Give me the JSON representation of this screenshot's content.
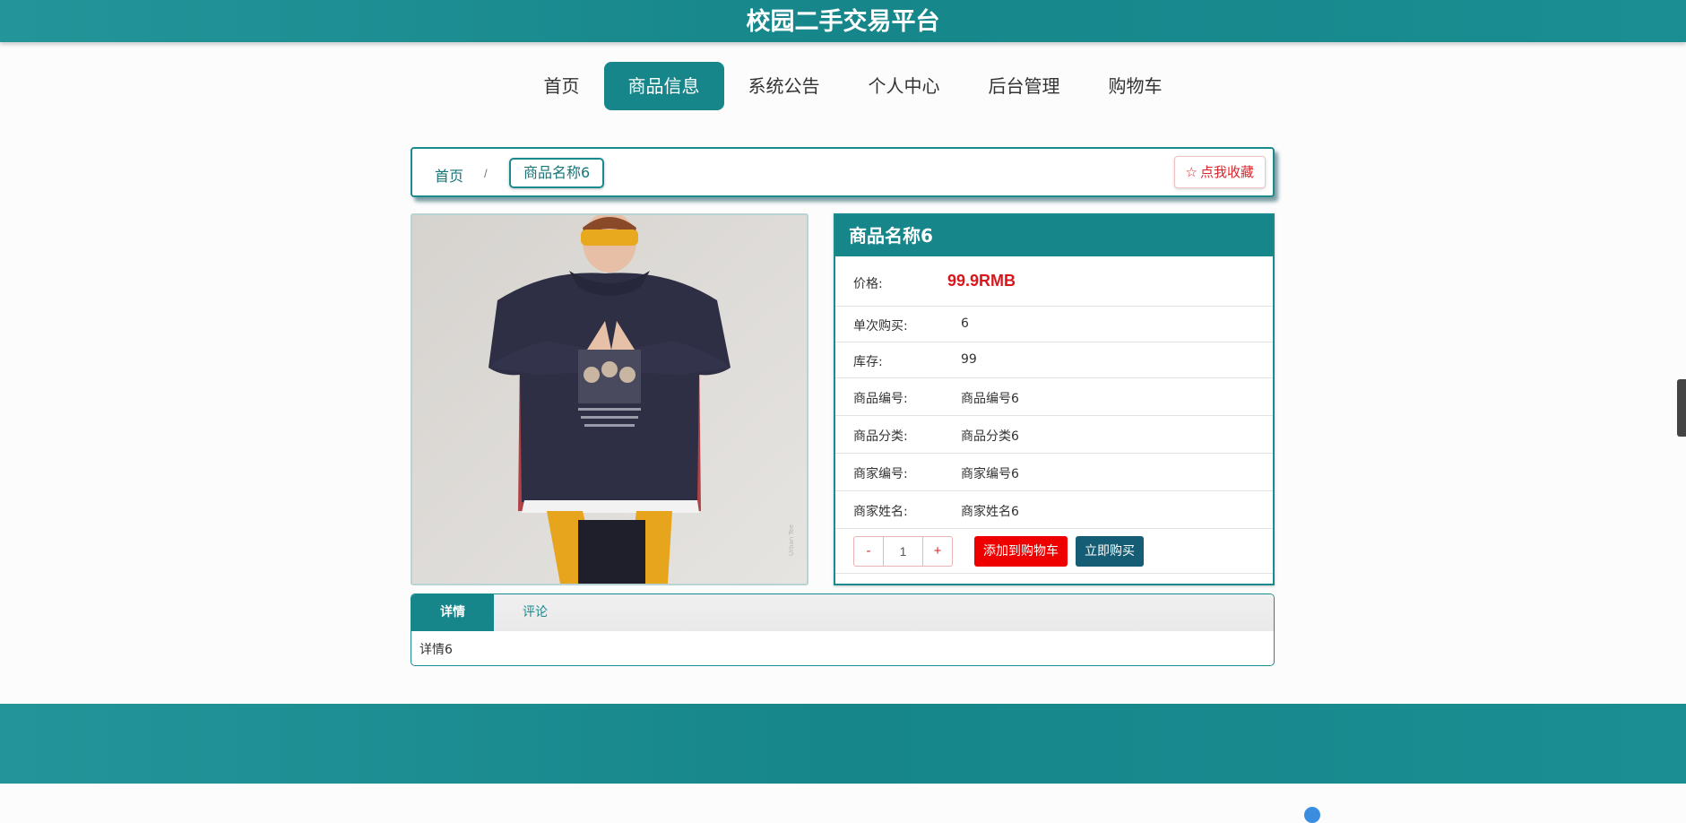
{
  "site": {
    "title": "校园二手交易平台"
  },
  "nav": {
    "items": [
      {
        "label": "首页"
      },
      {
        "label": "商品信息"
      },
      {
        "label": "系统公告"
      },
      {
        "label": "个人中心"
      },
      {
        "label": "后台管理"
      },
      {
        "label": "购物车"
      }
    ],
    "active_index": 1
  },
  "breadcrumb": {
    "home": "首页",
    "separator": "/",
    "current": "商品名称6"
  },
  "favorite_button": {
    "label": "点我收藏",
    "icon": "star-outline-icon"
  },
  "product": {
    "name": "商品名称6",
    "price_label": "价格:",
    "price": "99.9RMB",
    "rows": [
      {
        "label": "单次购买:",
        "value": "6"
      },
      {
        "label": "库存:",
        "value": "99"
      },
      {
        "label": "商品编号:",
        "value": "商品编号6"
      },
      {
        "label": "商品分类:",
        "value": "商品分类6"
      },
      {
        "label": "商家编号:",
        "value": "商家编号6"
      },
      {
        "label": "商家姓名:",
        "value": "商家姓名6"
      }
    ],
    "quantity": {
      "minus": "-",
      "value": "1",
      "plus": "+"
    },
    "add_to_cart": "添加到购物车",
    "buy_now": "立即购买"
  },
  "tabs": {
    "items": [
      {
        "label": "详情"
      },
      {
        "label": "评论"
      }
    ],
    "active_index": 0,
    "content": "详情6"
  },
  "colors": {
    "primary": "#16868a",
    "price": "#d9161c",
    "add_to_cart": "#ee0000",
    "buy_now": "#155d75"
  }
}
